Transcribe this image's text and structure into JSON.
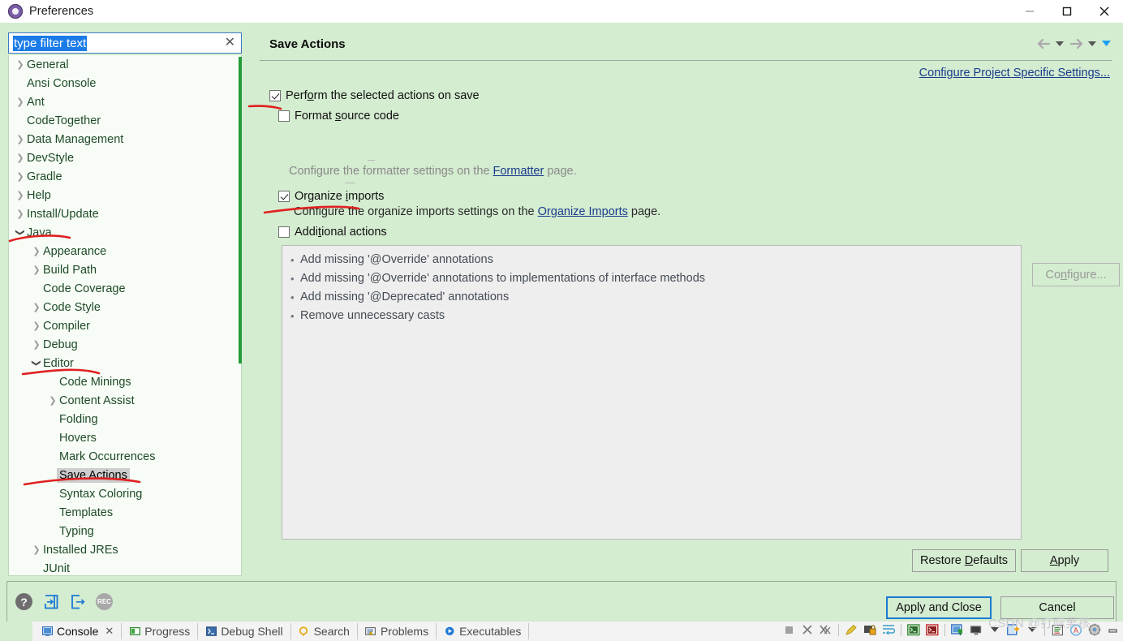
{
  "window": {
    "title": "Preferences",
    "icon": "preferences-gear-icon",
    "minimize_label": "—",
    "maximize_label": "☐",
    "close_label": "✕"
  },
  "filter": {
    "value": "type filter text",
    "clear_label": "✕"
  },
  "tree": {
    "items": [
      {
        "label": "General",
        "indent": 0,
        "arrow": "right"
      },
      {
        "label": "Ansi Console",
        "indent": 0,
        "arrow": "none"
      },
      {
        "label": "Ant",
        "indent": 0,
        "arrow": "right"
      },
      {
        "label": "CodeTogether",
        "indent": 0,
        "arrow": "none"
      },
      {
        "label": "Data Management",
        "indent": 0,
        "arrow": "right"
      },
      {
        "label": "DevStyle",
        "indent": 0,
        "arrow": "right"
      },
      {
        "label": "Gradle",
        "indent": 0,
        "arrow": "right"
      },
      {
        "label": "Help",
        "indent": 0,
        "arrow": "right"
      },
      {
        "label": "Install/Update",
        "indent": 0,
        "arrow": "right"
      },
      {
        "label": "Java",
        "indent": 0,
        "arrow": "down"
      },
      {
        "label": "Appearance",
        "indent": 1,
        "arrow": "right"
      },
      {
        "label": "Build Path",
        "indent": 1,
        "arrow": "right"
      },
      {
        "label": "Code Coverage",
        "indent": 1,
        "arrow": "none"
      },
      {
        "label": "Code Style",
        "indent": 1,
        "arrow": "right"
      },
      {
        "label": "Compiler",
        "indent": 1,
        "arrow": "right"
      },
      {
        "label": "Debug",
        "indent": 1,
        "arrow": "right"
      },
      {
        "label": "Editor",
        "indent": 1,
        "arrow": "down"
      },
      {
        "label": "Code Minings",
        "indent": 2,
        "arrow": "none"
      },
      {
        "label": "Content Assist",
        "indent": 2,
        "arrow": "right"
      },
      {
        "label": "Folding",
        "indent": 2,
        "arrow": "none"
      },
      {
        "label": "Hovers",
        "indent": 2,
        "arrow": "none"
      },
      {
        "label": "Mark Occurrences",
        "indent": 2,
        "arrow": "none"
      },
      {
        "label": "Save Actions",
        "indent": 2,
        "arrow": "none",
        "selected": true
      },
      {
        "label": "Syntax Coloring",
        "indent": 2,
        "arrow": "none"
      },
      {
        "label": "Templates",
        "indent": 2,
        "arrow": "none"
      },
      {
        "label": "Typing",
        "indent": 2,
        "arrow": "none"
      },
      {
        "label": "Installed JREs",
        "indent": 1,
        "arrow": "right"
      },
      {
        "label": "JUnit",
        "indent": 1,
        "arrow": "none"
      }
    ]
  },
  "pane": {
    "title": "Save Actions",
    "project_settings_link": "Configure Project Specific Settings...",
    "nav": {
      "back_icon": "arrow-left-icon",
      "back_caret_icon": "chevron-down-icon",
      "forward_icon": "arrow-right-icon",
      "forward_caret_icon": "chevron-down-icon",
      "menu_caret_icon": "chevron-down-blue-icon"
    },
    "checkboxes": [
      {
        "label_pre": "Perf",
        "label_key": "o",
        "label_post": "rm the selected actions on save",
        "checked": true
      },
      {
        "label_pre": "Format ",
        "label_key": "s",
        "label_post": "ource code",
        "checked": false
      },
      {
        "label_pre": "Organize ",
        "label_key": "i",
        "label_post": "mports",
        "checked": true
      },
      {
        "label_pre": "Addi",
        "label_key": "t",
        "label_post": "ional actions",
        "checked": false
      }
    ],
    "formatter_hint_pre": "Configure the formatter settings on the ",
    "formatter_hint_link": "Formatter",
    "formatter_hint_post": " page.",
    "organize_hint_pre": "Configure the organize imports settings on the ",
    "organize_hint_link": "Organize Imports",
    "organize_hint_post": " page.",
    "actions_list": [
      "Add missing '@Override' annotations",
      "Add missing '@Override' annotations to implementations of interface methods",
      "Add missing '@Deprecated' annotations",
      "Remove unnecessary casts"
    ],
    "configure_button": {
      "pre": "Co",
      "key": "n",
      "post": "figure...",
      "enabled": false
    },
    "restore_button": {
      "pre": "Restore ",
      "key": "D",
      "post": "efaults"
    },
    "apply_button": {
      "pre": "",
      "key": "A",
      "post": "pply"
    }
  },
  "bottom": {
    "help_icon": "help-question-icon",
    "import_icon": "import-arrow-icon",
    "export_icon": "export-arrow-icon",
    "rec_icon": "record-icon",
    "rec_label": "REC",
    "help_label": "?",
    "apply_and_close_label": "Apply and Close",
    "cancel_label": "Cancel"
  },
  "view_tabs": [
    {
      "label": "Console",
      "icon": "console-icon",
      "active": true,
      "closable": true
    },
    {
      "label": "Progress",
      "icon": "progress-icon",
      "active": false,
      "closable": false
    },
    {
      "label": "Debug Shell",
      "icon": "debug-shell-icon",
      "active": false,
      "closable": false
    },
    {
      "label": "Search",
      "icon": "search-icon",
      "active": false,
      "closable": false
    },
    {
      "label": "Problems",
      "icon": "problems-icon",
      "active": false,
      "closable": false
    },
    {
      "label": "Executables",
      "icon": "executables-icon",
      "active": false,
      "closable": false
    }
  ],
  "right_toolbar": [
    "stop-square-icon",
    "close-x-icon",
    "close-all-x-icon",
    "clear-console-icon",
    "lock-scroll-icon",
    "word-wrap-icon",
    "open-console-icon",
    "terminate-console-icon",
    "pin-console-icon",
    "display-selected-console-icon",
    "chevron-down-icon",
    "new-console-icon",
    "chevron-down-icon",
    "clipboard-icon",
    "ansi-icon",
    "gear-icon",
    "minimize-icon"
  ],
  "watermark": "CSDN @打际男孩",
  "colors": {
    "dialog_bg": "#d4ecd0",
    "tree_bg": "#f7fdf6",
    "listbox_bg": "#eeeeee",
    "link": "#1a3c8c",
    "accent_blue": "#1a7ad4",
    "scroll_thumb": "#249c3a",
    "annotation_red": "#e02020"
  }
}
